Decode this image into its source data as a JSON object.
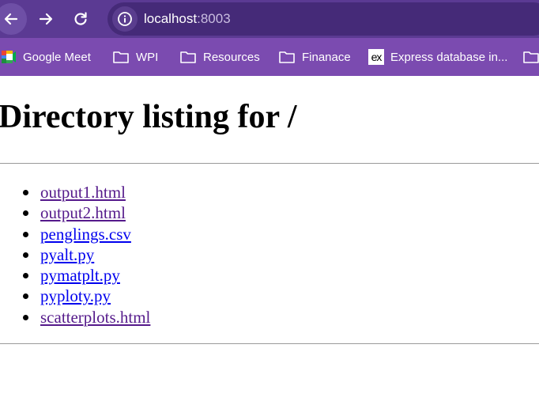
{
  "browser": {
    "url_host": "localhost",
    "url_port": ":8003",
    "bookmarks": [
      {
        "label": "Google Meet",
        "icon": "google-meet-icon"
      },
      {
        "label": "WPI",
        "icon": "folder-icon"
      },
      {
        "label": "Resources",
        "icon": "folder-icon"
      },
      {
        "label": "Finanace",
        "icon": "folder-icon"
      },
      {
        "label": "Express database in...",
        "icon": "ex-logo-icon",
        "icon_text": "ex"
      },
      {
        "label": "",
        "icon": "folder-icon"
      }
    ],
    "colors": {
      "toolbar": "#5b3a93",
      "omnibox": "#452a78",
      "bookmarks_bar": "#7b4bb0",
      "link": "#0000ee",
      "visited_link": "#551a8b"
    }
  },
  "page": {
    "title": "Directory listing for /",
    "files": [
      {
        "name": "output1.html",
        "visited": true
      },
      {
        "name": "output2.html",
        "visited": true
      },
      {
        "name": "penglings.csv",
        "visited": false
      },
      {
        "name": "pyalt.py",
        "visited": false
      },
      {
        "name": "pymatplt.py",
        "visited": false
      },
      {
        "name": "pyploty.py",
        "visited": false
      },
      {
        "name": "scatterplots.html",
        "visited": true
      }
    ]
  }
}
